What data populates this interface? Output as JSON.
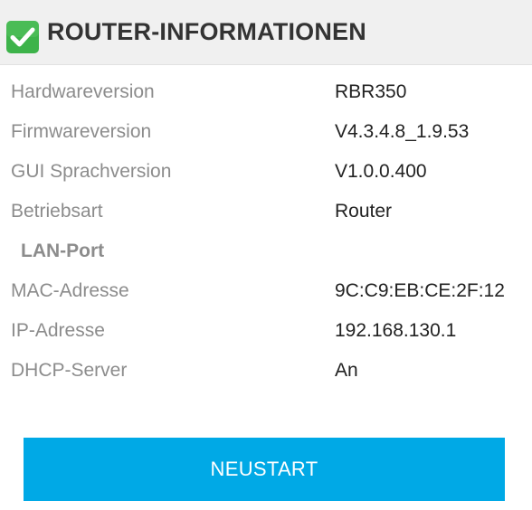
{
  "header": {
    "title": "ROUTER-INFORMATIONEN",
    "icon": "checkmark-icon",
    "icon_color": "#3db34a"
  },
  "info_rows": [
    {
      "label": "Hardwareversion",
      "value": "RBR350"
    },
    {
      "label": "Firmwareversion",
      "value": "V4.3.4.8_1.9.53"
    },
    {
      "label": "GUI Sprachversion",
      "value": "V1.0.0.400"
    },
    {
      "label": "Betriebsart",
      "value": "Router"
    }
  ],
  "lan_section": {
    "heading": "LAN-Port",
    "rows": [
      {
        "label": "MAC-Adresse",
        "value": "9C:C9:EB:CE:2F:12"
      },
      {
        "label": "IP-Adresse",
        "value": "192.168.130.1"
      },
      {
        "label": "DHCP-Server",
        "value": "An"
      }
    ]
  },
  "actions": {
    "restart_label": "NEUSTART",
    "restart_color": "#00a9e6"
  }
}
